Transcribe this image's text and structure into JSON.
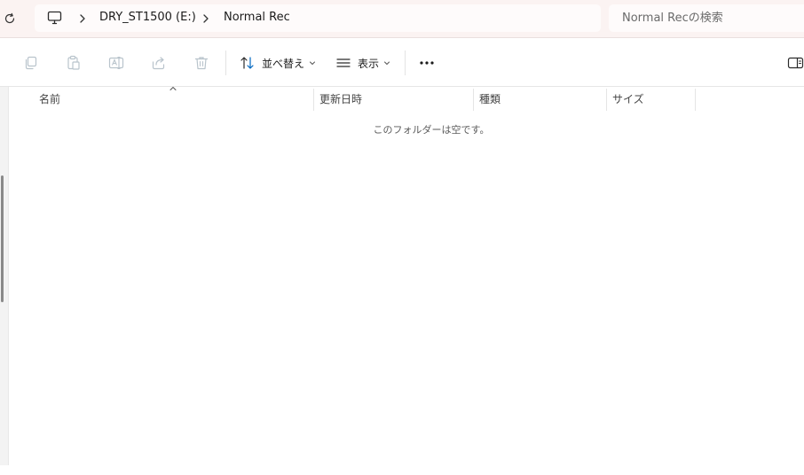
{
  "address_bar": {
    "breadcrumbs": [
      {
        "label": "DRY_ST1500 (E:)"
      },
      {
        "label": "Normal Rec"
      }
    ],
    "search_placeholder": "Normal Recの検索"
  },
  "icons": {
    "refresh": "refresh-icon",
    "this_pc": "monitor-icon",
    "copy": "copy-icon",
    "paste": "paste-icon",
    "rename": "rename-icon",
    "share": "share-icon",
    "delete": "trash-icon",
    "sort": "sort-arrows-icon",
    "view": "list-view-icon",
    "more": "ellipsis-icon",
    "details_pane": "details-pane-icon"
  },
  "command_bar": {
    "sort_label": "並べ替え",
    "view_label": "表示"
  },
  "file_list": {
    "columns": [
      {
        "label": "名前"
      },
      {
        "label": "更新日時"
      },
      {
        "label": "種類"
      },
      {
        "label": "サイズ"
      }
    ],
    "empty_message": "このフォルダーは空です。"
  },
  "colors": {
    "address_bar_background": "#fbf3f2",
    "disabled_icon": "#b9c4cc",
    "accent": "#0067c0"
  }
}
